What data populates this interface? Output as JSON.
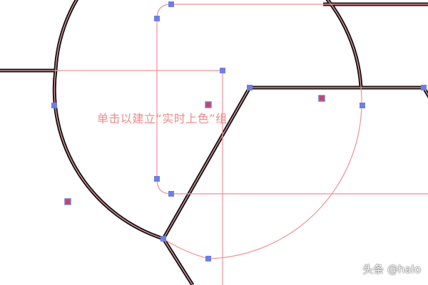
{
  "canvas": {
    "hint_text": "单击以建立“实时上色”组",
    "hint_color": "#f08a8a"
  },
  "watermark": {
    "text": "头条 @halo"
  },
  "colors": {
    "path_outer": "#1a1414",
    "path_inner": "#e8a0a8",
    "guide_line": "#f09098",
    "anchor_point": "#6f7fe0",
    "center_point_fill": "#d04060",
    "center_point_border": "#6f7fe0",
    "background": "#ffffff"
  }
}
